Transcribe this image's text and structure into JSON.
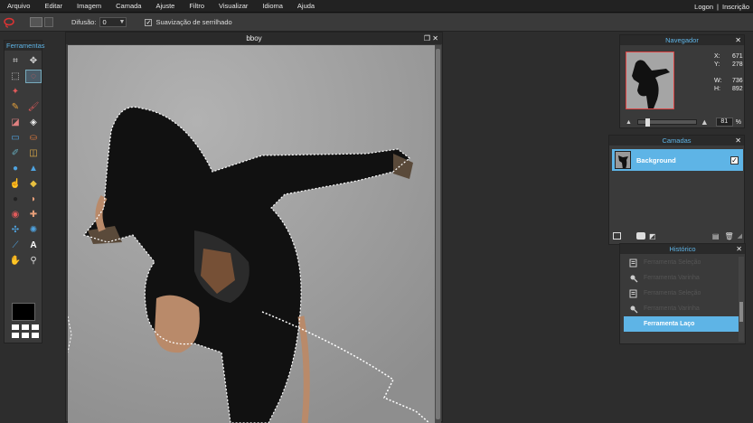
{
  "menu": [
    "Arquivo",
    "Editar",
    "Imagem",
    "Camada",
    "Ajuste",
    "Filtro",
    "Visualizar",
    "Idioma",
    "Ajuda"
  ],
  "account": {
    "login": "Logon",
    "separator": "|",
    "signup": "Inscrição"
  },
  "options": {
    "diffusion_label": "Difusão:",
    "diffusion_value": "0",
    "antialias_checked": true,
    "antialias_label": "Suavização de serrilhado"
  },
  "tools_panel": {
    "title": "Ferramentas",
    "icons": [
      "crop-icon",
      "move-icon",
      "marquee-icon",
      "lasso-icon",
      "magic-wand-icon",
      "",
      "pencil-icon",
      "brush-icon",
      "eraser-icon",
      "fill-icon",
      "gradient-icon",
      "stamp-icon",
      "color-replace-icon",
      "picker-icon",
      "blur-icon",
      "sharpen-icon",
      "smudge-icon",
      "sponge-icon",
      "burn-icon",
      "dodge-icon",
      "red-eye-icon",
      "spot-heal-icon",
      "bloat-icon",
      "pinch-icon",
      "eyedropper-icon",
      "text-icon",
      "hand-icon",
      "zoom-icon"
    ],
    "selected": "lasso-icon",
    "foreground_color": "#000000"
  },
  "document": {
    "title": "bboy"
  },
  "navigator": {
    "title": "Navegador",
    "x_label": "X:",
    "x_value": "671",
    "y_label": "Y:",
    "y_value": "278",
    "w_label": "W:",
    "w_value": "736",
    "h_label": "H:",
    "h_value": "892",
    "zoom": "81",
    "zoom_unit": "%"
  },
  "layers": {
    "title": "Camadas",
    "items": [
      {
        "name": "Background",
        "visible": true
      }
    ]
  },
  "history": {
    "title": "Histórico",
    "items": [
      {
        "label": "Ferramenta Seleção",
        "active": false
      },
      {
        "label": "Ferramenta Varinha",
        "active": false
      },
      {
        "label": "Ferramenta Seleção",
        "active": false
      },
      {
        "label": "Ferramenta Varinha",
        "active": false
      },
      {
        "label": "Ferramenta Laço",
        "active": true
      }
    ]
  },
  "colors": {
    "accent": "#5eb4e6",
    "panel": "#3a3a3a",
    "title": "#2a2a2a"
  }
}
